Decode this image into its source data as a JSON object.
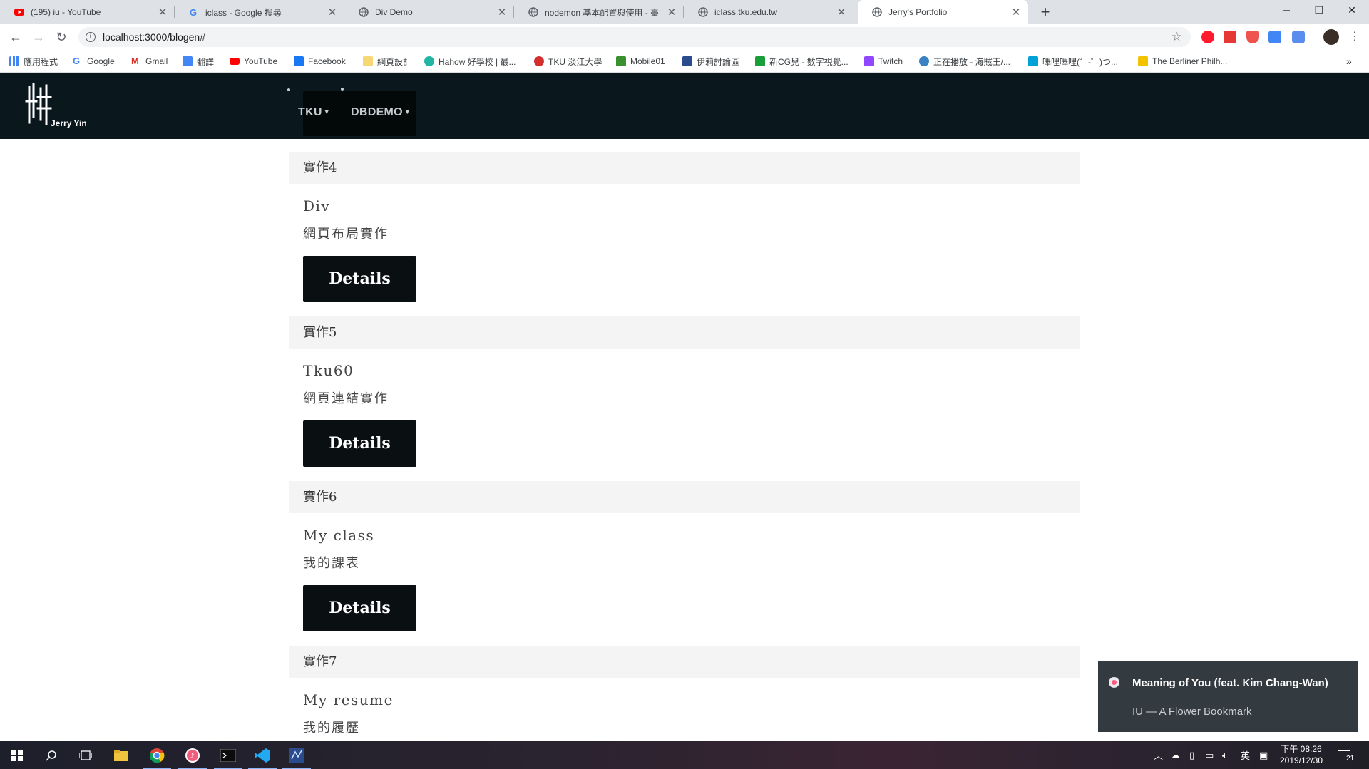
{
  "browser": {
    "tabs": [
      {
        "title": "(195) iu - YouTube",
        "icon": "youtube-icon",
        "active": false
      },
      {
        "title": "iclass - Google 搜尋",
        "icon": "google-icon",
        "active": false
      },
      {
        "title": "Div Demo",
        "icon": "globe-icon",
        "active": false
      },
      {
        "title": "nodemon 基本配置與使用 - 臺",
        "icon": "globe-icon",
        "active": false
      },
      {
        "title": "iclass.tku.edu.tw",
        "icon": "globe-icon",
        "active": false
      },
      {
        "title": "Jerry's Portfolio",
        "icon": "globe-icon",
        "active": true
      }
    ],
    "url": "localhost:3000/blogen#",
    "bookmarks": [
      {
        "label": "應用程式",
        "icon": "apps-grid-icon",
        "color": "#4285f4"
      },
      {
        "label": "Google",
        "icon": "google-icon",
        "color": "#4285f4"
      },
      {
        "label": "Gmail",
        "icon": "gmail-icon",
        "color": "#d93025"
      },
      {
        "label": "翻譯",
        "icon": "translate-icon",
        "color": "#4285f4"
      },
      {
        "label": "YouTube",
        "icon": "youtube-icon",
        "color": "#ff0000"
      },
      {
        "label": "Facebook",
        "icon": "facebook-icon",
        "color": "#1877f2"
      },
      {
        "label": "網頁設計",
        "icon": "folder-icon",
        "color": "#f7d774"
      },
      {
        "label": "Hahow 好學校 | 最...",
        "icon": "hahow-icon",
        "color": "#22b5a3"
      },
      {
        "label": "TKU 淡江大學",
        "icon": "tku-icon",
        "color": "#d32f2f"
      },
      {
        "label": "Mobile01",
        "icon": "mobile01-icon",
        "color": "#3a8f2f"
      },
      {
        "label": "伊莉討論區",
        "icon": "eyny-icon",
        "color": "#2b4c8c"
      },
      {
        "label": "新CG兒 - 數字視覺...",
        "icon": "cgjoy-icon",
        "color": "#1a9e3a"
      },
      {
        "label": "Twitch",
        "icon": "twitch-icon",
        "color": "#9146ff"
      },
      {
        "label": "正在播放 - 海賊王/...",
        "icon": "anime-icon",
        "color": "#3b82c4"
      },
      {
        "label": "嗶哩嗶哩(゜-゜)つ...",
        "icon": "bilibili-icon",
        "color": "#00a1d6"
      },
      {
        "label": "The Berliner Philh...",
        "icon": "berliner-icon",
        "color": "#f3c300"
      }
    ]
  },
  "site": {
    "brand": "Jerry Yin",
    "nav": [
      {
        "label": "TKU"
      },
      {
        "label": "DBDEMO"
      }
    ],
    "details_label": "Details",
    "cards": [
      {
        "header": "實作4",
        "title": "Div",
        "text": "網頁布局實作"
      },
      {
        "header": "實作5",
        "title": "Tku60",
        "text": "網頁連結實作"
      },
      {
        "header": "實作6",
        "title": "My class",
        "text": "我的課表"
      },
      {
        "header": "實作7",
        "title": "My resume",
        "text": "我的履歷"
      }
    ]
  },
  "toast": {
    "title": "Meaning of You (feat. Kim Chang-Wan)",
    "subtitle": "IU — A Flower Bookmark"
  },
  "taskbar": {
    "ime": "英",
    "time": "下午 08:26",
    "date": "2019/12/30",
    "notifications": "21"
  }
}
